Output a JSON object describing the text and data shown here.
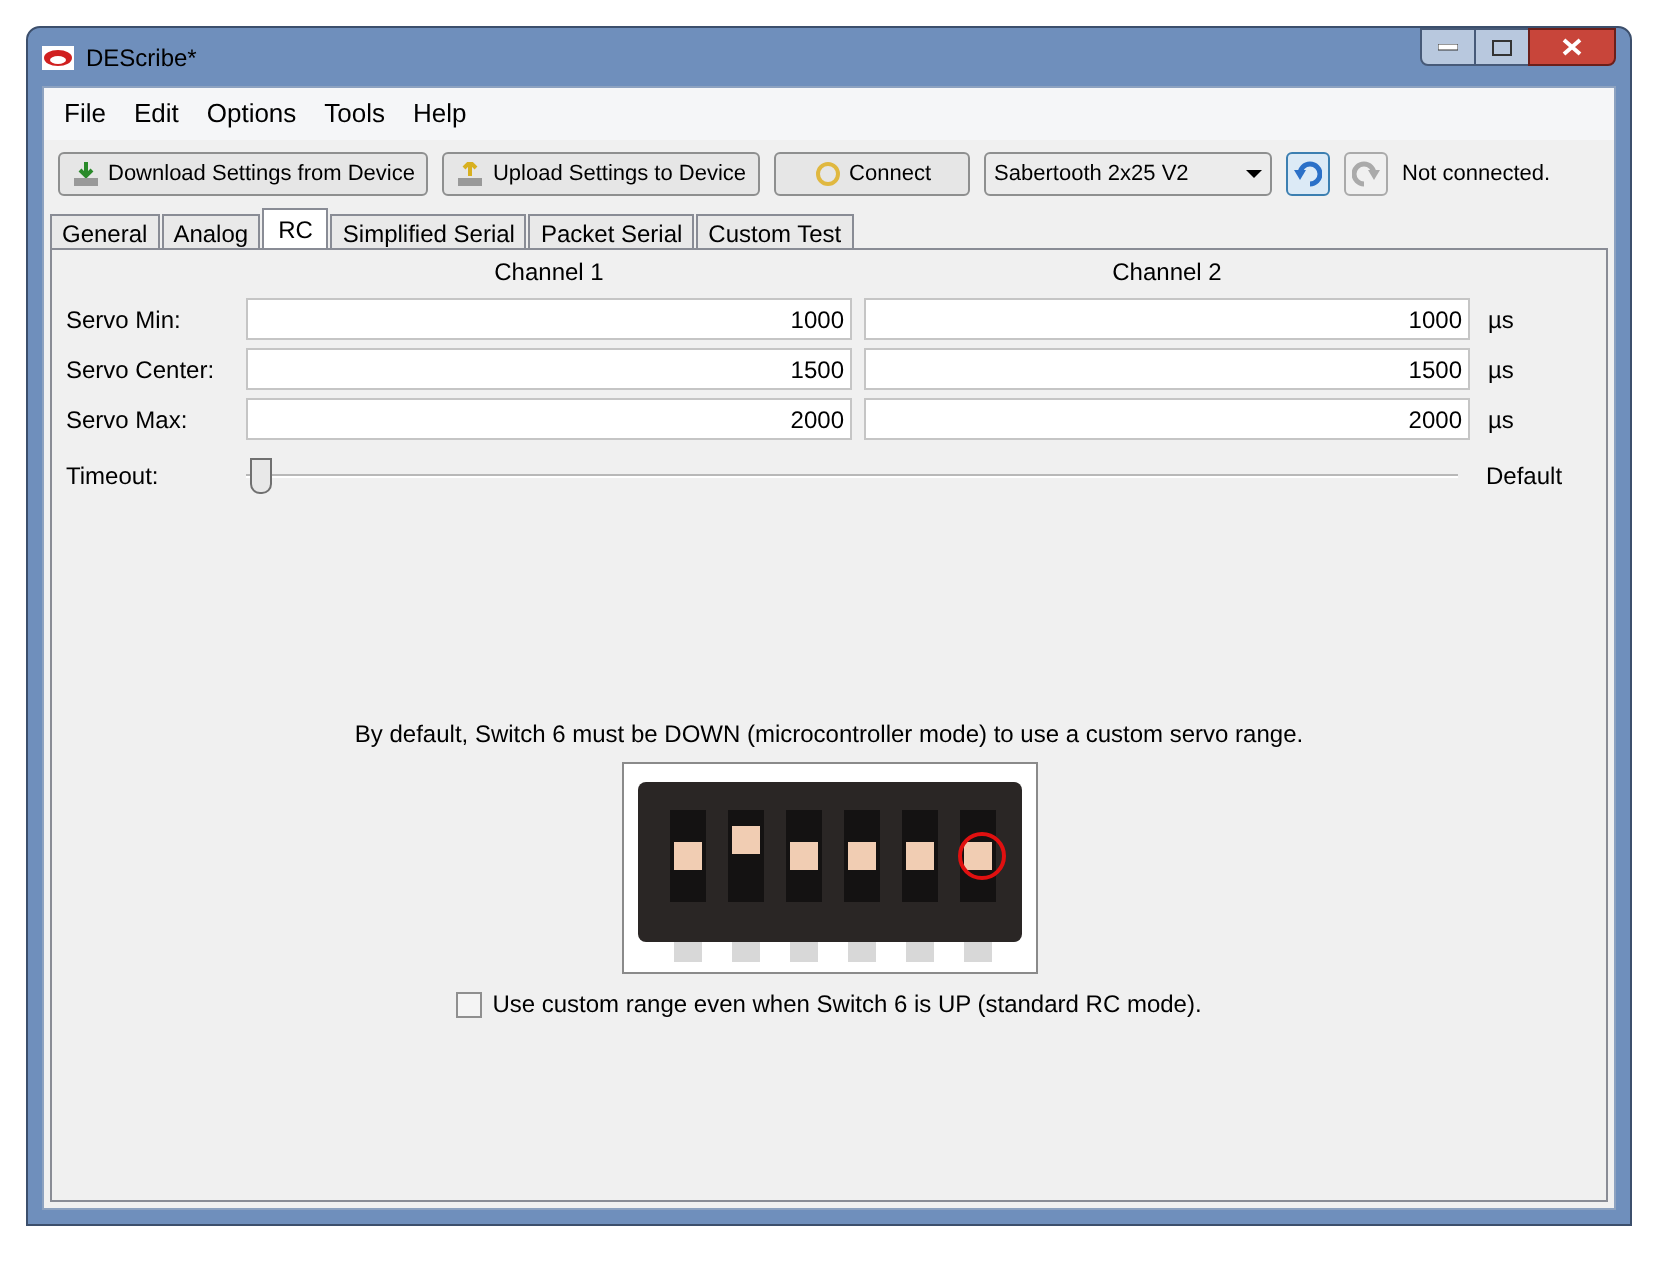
{
  "window": {
    "title": "DEScribe*"
  },
  "menu": [
    "File",
    "Edit",
    "Options",
    "Tools",
    "Help"
  ],
  "toolbar": {
    "download": "Download Settings from Device",
    "upload": "Upload Settings to Device",
    "connect": "Connect",
    "device": "Sabertooth 2x25 V2",
    "status": "Not connected."
  },
  "tabs": [
    {
      "label": "General",
      "selected": false
    },
    {
      "label": "Analog",
      "selected": false
    },
    {
      "label": "RC",
      "selected": true
    },
    {
      "label": "Simplified Serial",
      "selected": false
    },
    {
      "label": "Packet Serial",
      "selected": false
    },
    {
      "label": "Custom Test",
      "selected": false
    }
  ],
  "columns": [
    "Channel 1",
    "Channel 2"
  ],
  "rows": [
    {
      "label": "Servo Min:",
      "values": [
        "1000",
        "1000"
      ],
      "unit": "µs"
    },
    {
      "label": "Servo Center:",
      "values": [
        "1500",
        "1500"
      ],
      "unit": "µs"
    },
    {
      "label": "Servo Max:",
      "values": [
        "2000",
        "2000"
      ],
      "unit": "µs"
    }
  ],
  "timeout": {
    "label": "Timeout:",
    "level": 0,
    "reading": "Default"
  },
  "note": "By default, Switch 6 must be DOWN (microcontroller mode) to use a custom servo range.",
  "photo": {
    "kind": "picture"
  },
  "custom_range": {
    "label": "Use custom range even when Switch 6 is UP (standard RC mode).",
    "checked": false
  }
}
